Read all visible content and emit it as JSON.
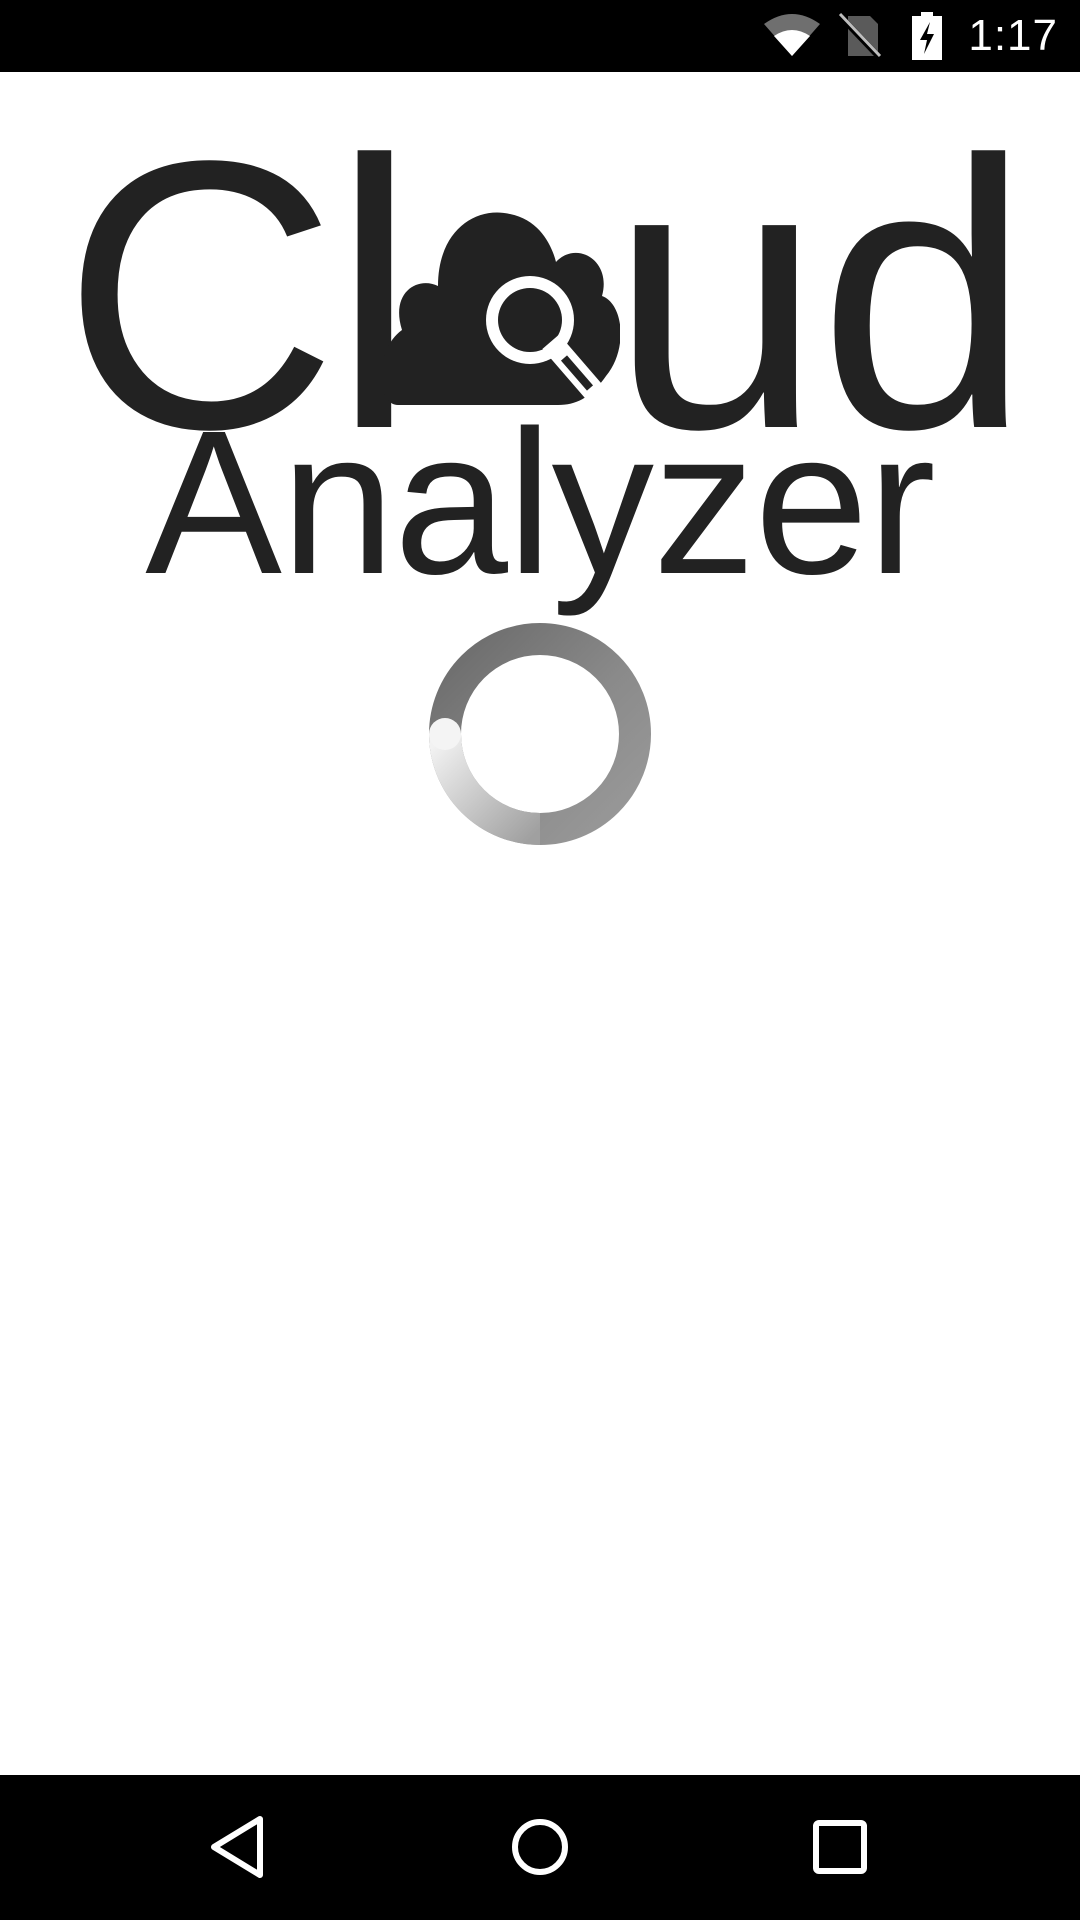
{
  "status_bar": {
    "time": "1:17",
    "icons": [
      "wifi-icon",
      "no-sim-icon",
      "battery-charging-icon"
    ]
  },
  "splash": {
    "logo_line1_left": "Cl",
    "logo_line1_right": "ud",
    "logo_line2": "Analyzer",
    "logo_icon": "cloud-search-icon",
    "loading_indicator": "spinner"
  },
  "nav_bar": {
    "buttons": [
      "back-icon",
      "home-icon",
      "recents-icon"
    ]
  },
  "colors": {
    "status_bar_bg": "#000000",
    "nav_bar_bg": "#000000",
    "logo_text": "#222222",
    "background": "#ffffff"
  }
}
